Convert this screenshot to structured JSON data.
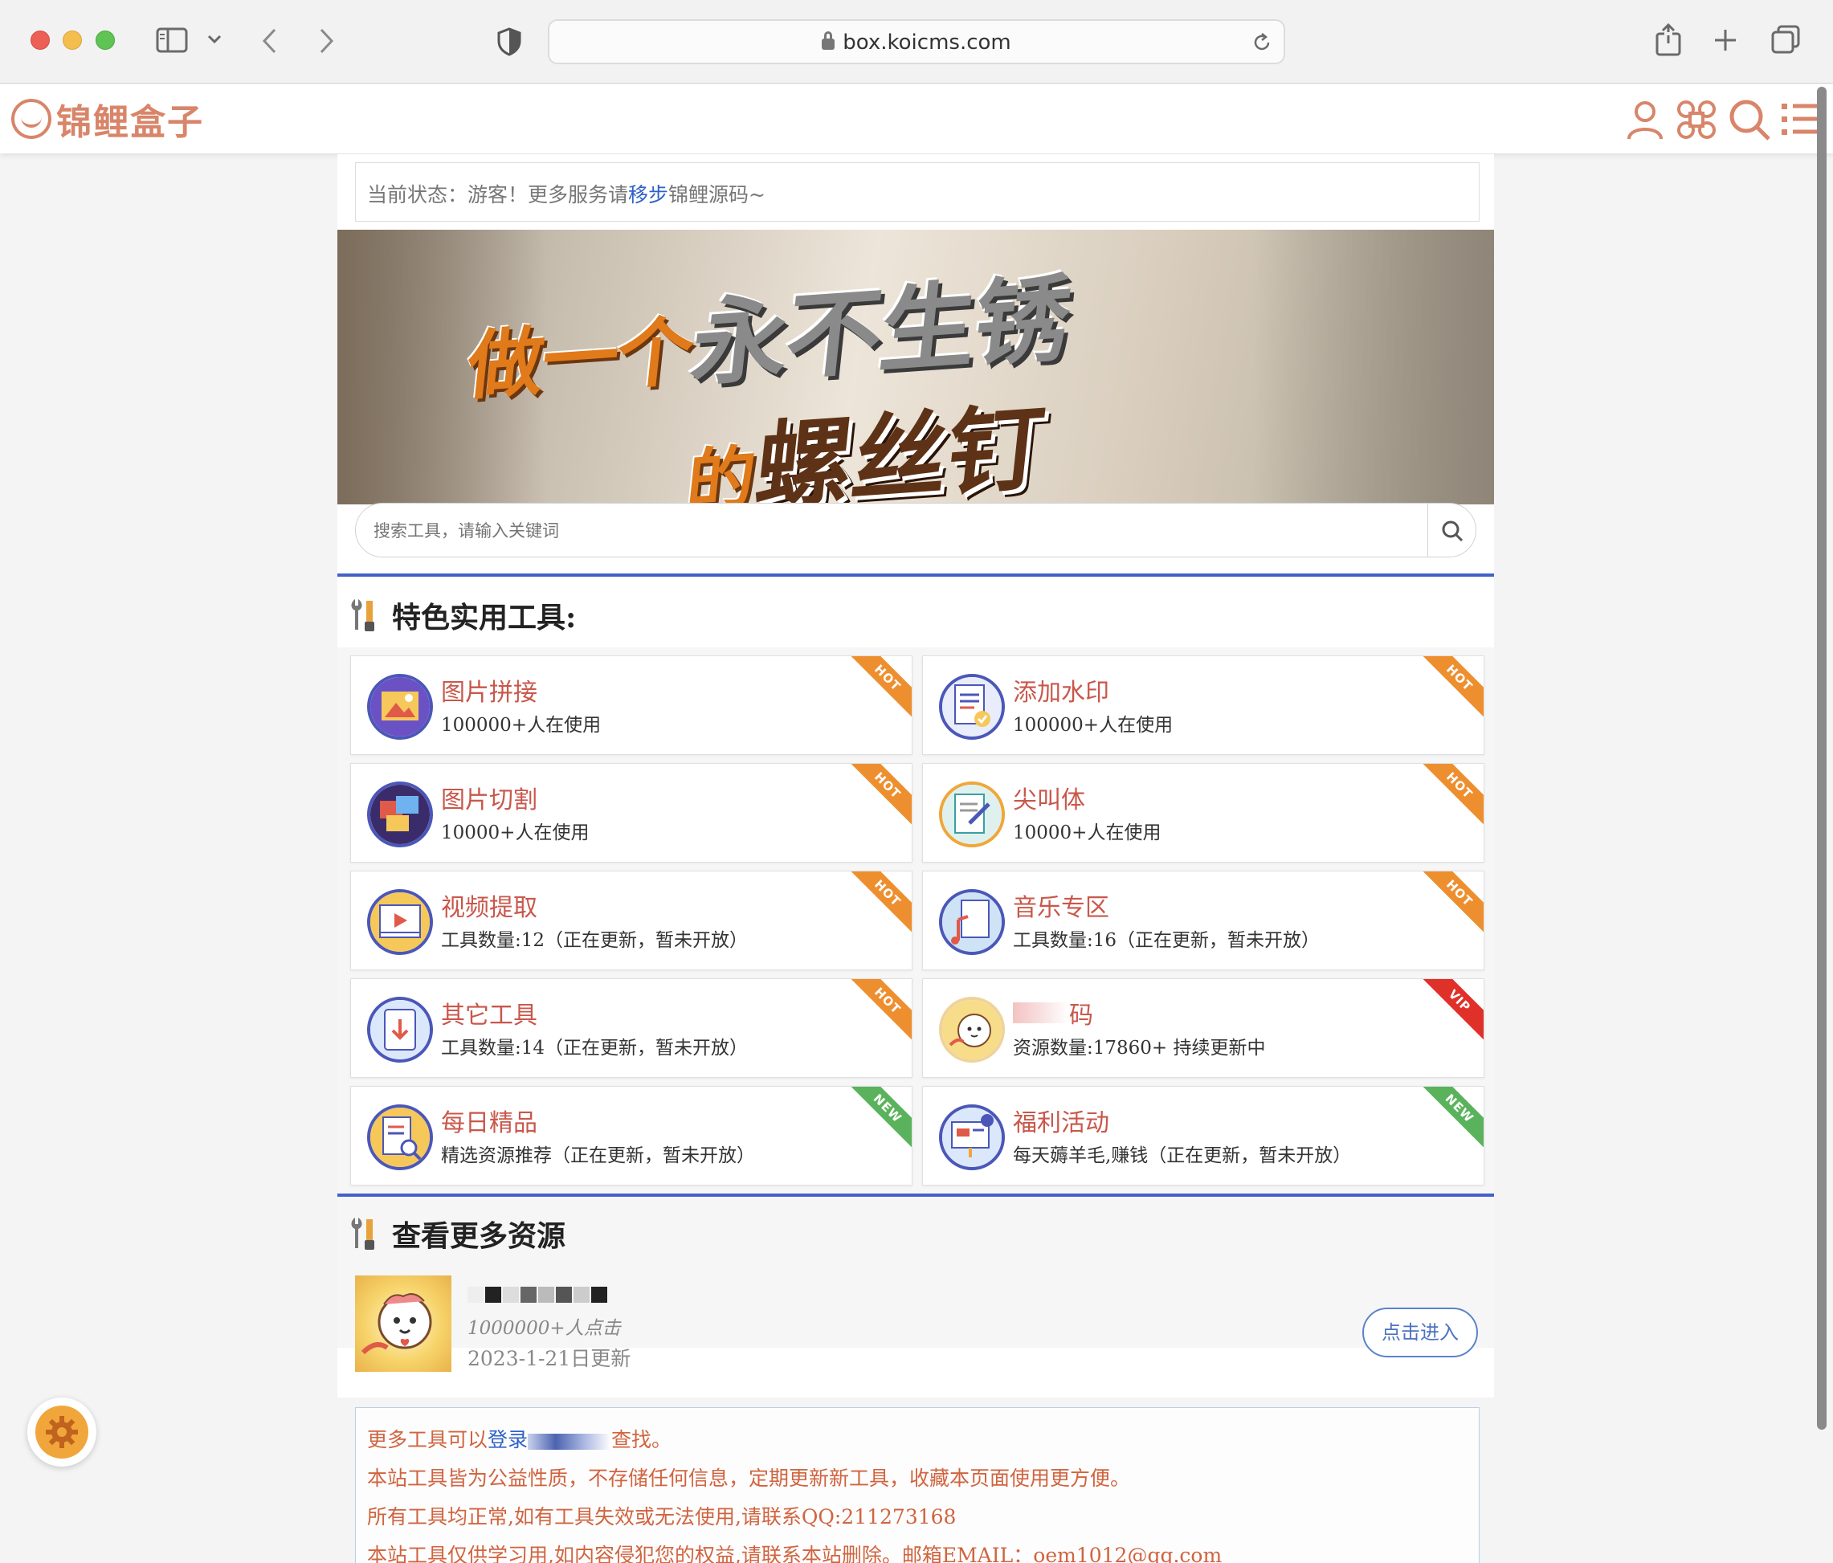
{
  "browser": {
    "url": "box.koicms.com"
  },
  "site": {
    "logo_text": "锦鲤盒子"
  },
  "status": {
    "prefix": "当前状态：游客！更多服务请",
    "link": "移步",
    "suffix": "锦鲤源码~"
  },
  "banner": {
    "line1_a": "做一个",
    "line1_b": "永不生锈",
    "line2_a": "的",
    "line2_b": "螺丝钉"
  },
  "search": {
    "placeholder": "搜索工具，请输入关键词"
  },
  "section1": {
    "title": "特色实用工具:"
  },
  "tools": [
    {
      "title": "图片拼接",
      "subtitle": "100000+人在使用",
      "badge": "HOT"
    },
    {
      "title": "添加水印",
      "subtitle": "100000+人在使用",
      "badge": "HOT"
    },
    {
      "title": "图片切割",
      "subtitle": "10000+人在使用",
      "badge": "HOT"
    },
    {
      "title": "尖叫体",
      "subtitle": "10000+人在使用",
      "badge": "HOT"
    },
    {
      "title": "视频提取",
      "subtitle": "工具数量:12（正在更新，暂未开放）",
      "badge": "HOT"
    },
    {
      "title": "音乐专区",
      "subtitle": "工具数量:16（正在更新，暂未开放）",
      "badge": "HOT"
    },
    {
      "title": "其它工具",
      "subtitle": "工具数量:14（正在更新，暂未开放）",
      "badge": "HOT"
    },
    {
      "title": "码",
      "subtitle": "资源数量:17860+ 持续更新中",
      "badge": "VIP"
    },
    {
      "title": "每日精品",
      "subtitle": "精选资源推荐（正在更新，暂未开放）",
      "badge": "NEW"
    },
    {
      "title": "福利活动",
      "subtitle": "每天薅羊毛,赚钱（正在更新，暂未开放）",
      "badge": "NEW"
    }
  ],
  "section2": {
    "title": "查看更多资源"
  },
  "resource": {
    "clicks": "1000000+人点击",
    "date": "2023-1-21日更新",
    "button": "点击进入"
  },
  "notice": {
    "line1_prefix": "更多工具可以",
    "line1_link": "登录",
    "line1_suffix": "查找。",
    "line2": "本站工具皆为公益性质，不存储任何信息，定期更新新工具，收藏本页面使用更方便。",
    "line3": "所有工具均正常,如有工具失效或无法使用,请联系QQ:211273168",
    "line4": "本站工具仅供学习用,如内容侵犯您的权益,请联系本站删除。邮箱EMAIL：oem1012@qq.com"
  },
  "colors": {
    "brand": "#d8856a",
    "title_red": "#c9574b",
    "section_blue": "#4461c9",
    "hot": "#ee8f2f",
    "vip": "#e0302a",
    "new": "#5ab35c",
    "notice_text": "#d0643f"
  }
}
